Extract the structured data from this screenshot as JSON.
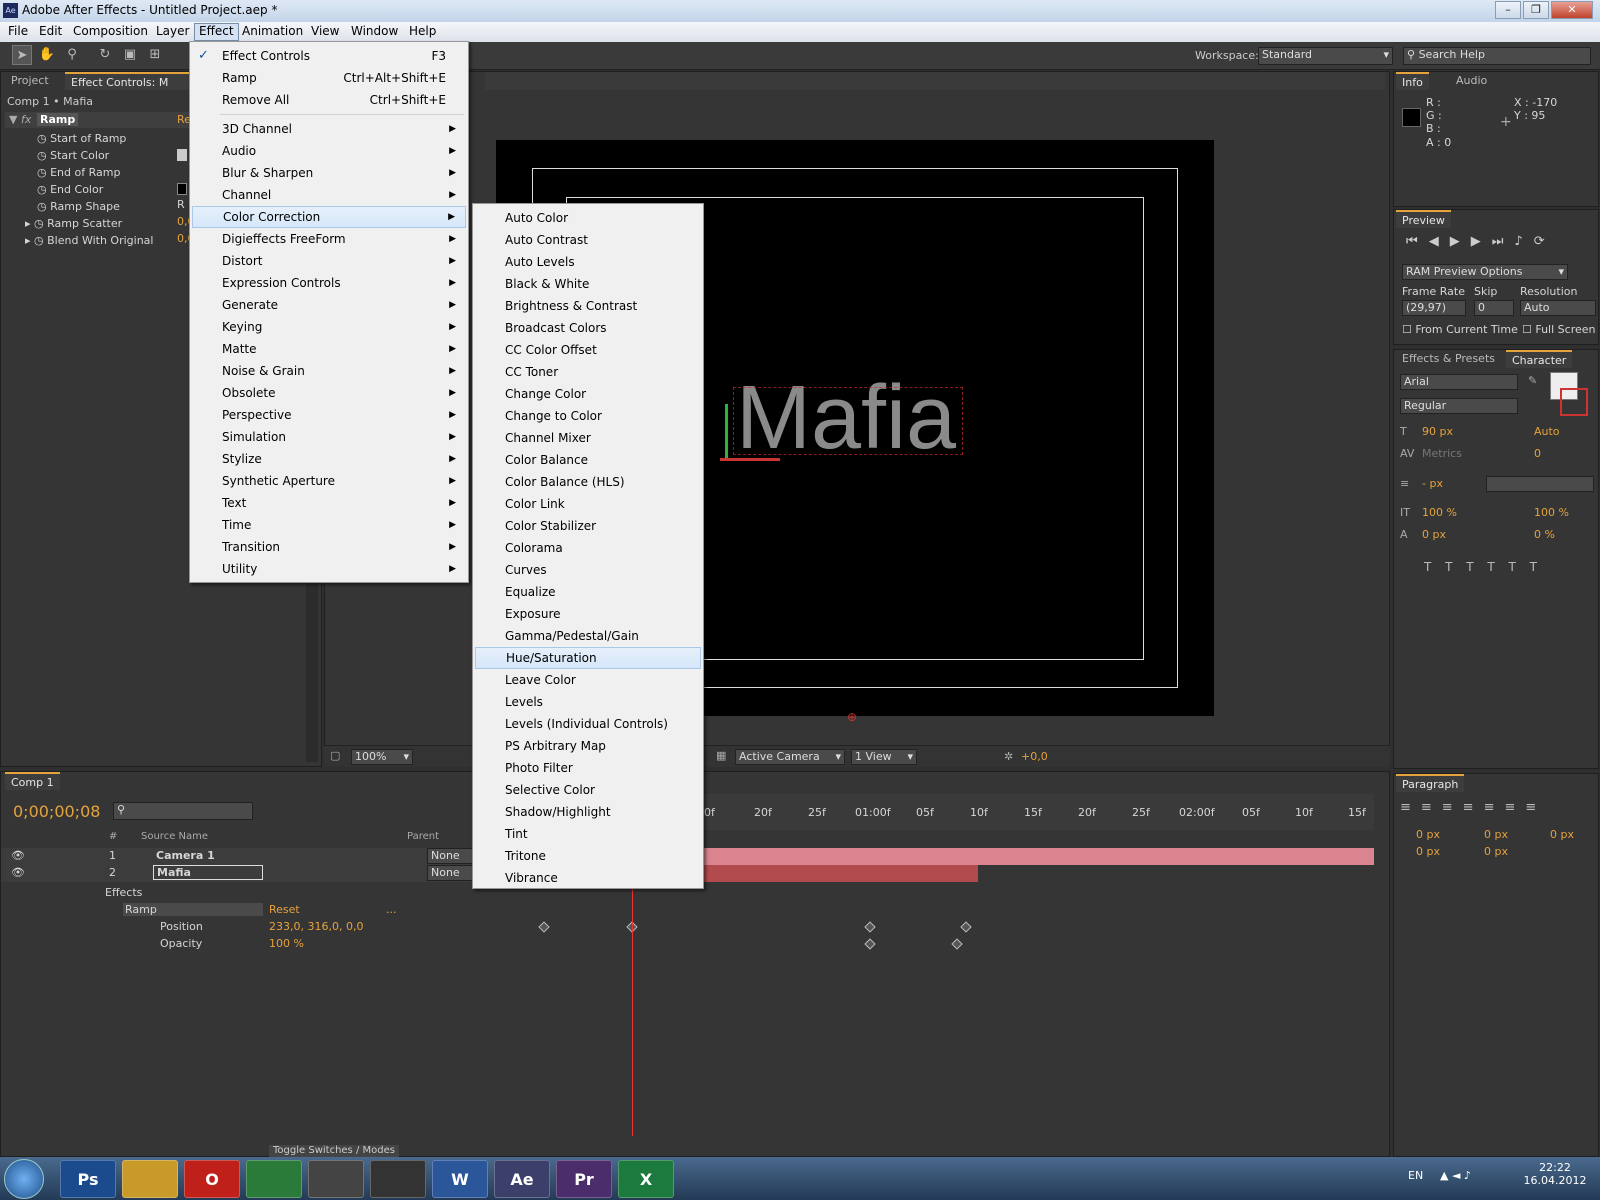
{
  "app": {
    "title": "Adobe After Effects - Untitled Project.aep *",
    "icon": "Ae"
  },
  "menubar": [
    "File",
    "Edit",
    "Composition",
    "Layer",
    "Effect",
    "Animation",
    "View",
    "Window",
    "Help"
  ],
  "toolbar": {
    "workspace_label": "Workspace:",
    "workspace_value": "Standard",
    "search_placeholder": "Search Help"
  },
  "effect_menu": {
    "top": [
      {
        "label": "Effect Controls",
        "shortcut": "F3",
        "checked": true
      },
      {
        "label": "Ramp",
        "shortcut": "Ctrl+Alt+Shift+E"
      },
      {
        "label": "Remove All",
        "shortcut": "Ctrl+Shift+E"
      }
    ],
    "categories": [
      "3D Channel",
      "Audio",
      "Blur & Sharpen",
      "Channel",
      "Color Correction",
      "Digieffects FreeForm",
      "Distort",
      "Expression Controls",
      "Generate",
      "Keying",
      "Matte",
      "Noise & Grain",
      "Obsolete",
      "Perspective",
      "Simulation",
      "Stylize",
      "Synthetic Aperture",
      "Text",
      "Time",
      "Transition",
      "Utility"
    ],
    "highlighted": "Color Correction"
  },
  "color_correction_menu": {
    "items": [
      "Auto Color",
      "Auto Contrast",
      "Auto Levels",
      "Black & White",
      "Brightness & Contrast",
      "Broadcast Colors",
      "CC Color Offset",
      "CC Toner",
      "Change Color",
      "Change to Color",
      "Channel Mixer",
      "Color Balance",
      "Color Balance (HLS)",
      "Color Link",
      "Color Stabilizer",
      "Colorama",
      "Curves",
      "Equalize",
      "Exposure",
      "Gamma/Pedestal/Gain",
      "Hue/Saturation",
      "Leave Color",
      "Levels",
      "Levels (Individual Controls)",
      "PS Arbitrary Map",
      "Photo Filter",
      "Selective Color",
      "Shadow/Highlight",
      "Tint",
      "Tritone",
      "Vibrance"
    ],
    "highlighted": "Hue/Saturation"
  },
  "effect_controls": {
    "tab_project": "Project",
    "tab_effect": "Effect Controls: M",
    "breadcrumb": "Comp 1 • Mafia",
    "effect_name": "Ramp",
    "reset": "Re",
    "props": [
      {
        "label": "Start of Ramp",
        "val": ""
      },
      {
        "label": "Start Color",
        "val": ""
      },
      {
        "label": "End of Ramp",
        "val": ""
      },
      {
        "label": "End Color",
        "val": ""
      },
      {
        "label": "Ramp Shape",
        "val": "R"
      },
      {
        "label": "Ramp Scatter",
        "val": "0,0"
      },
      {
        "label": "Blend With Original",
        "val": "0,0"
      }
    ]
  },
  "viewer": {
    "text": "Mafia",
    "zoom": "100%",
    "camera": "Active Camera",
    "views": "1 View",
    "exposure": "+0,0"
  },
  "info": {
    "tab_info": "Info",
    "tab_audio": "Audio",
    "r": "R :",
    "g": "G :",
    "b": "B :",
    "a": "A : 0",
    "x": "X : -170",
    "y": "Y : 95"
  },
  "preview": {
    "tab": "Preview",
    "ram_options": "RAM Preview Options",
    "frame_rate_label": "Frame Rate",
    "skip_label": "Skip",
    "resolution_label": "Resolution",
    "frame_rate": "(29,97)",
    "skip": "0",
    "resolution": "Auto",
    "from_current": "From Current Time",
    "full_screen": "Full Screen"
  },
  "character": {
    "tab_effects": "Effects & Presets",
    "tab_char": "Character",
    "font": "Arial",
    "style": "Regular",
    "size": "90 px",
    "leading": "Auto",
    "kerning": "Metrics",
    "tracking": "0",
    "stroke": "- px",
    "vscale": "100 %",
    "hscale": "100 %",
    "baseline": "0 px",
    "tsume": "0 %"
  },
  "paragraph": {
    "tab": "Paragraph",
    "v1": "0 px",
    "v2": "0 px",
    "v3": "0 px",
    "v4": "0 px",
    "v5": "0 px"
  },
  "timeline": {
    "tab": "Comp 1",
    "timecode": "0;00;00;08",
    "col_hash": "#",
    "col_source": "Source Name",
    "col_parent": "Parent",
    "ruler": [
      "0f",
      "20f",
      "25f",
      "01:00f",
      "05f",
      "10f",
      "15f",
      "20f",
      "25f",
      "02:00f",
      "05f",
      "10f",
      "15f"
    ],
    "layers": [
      {
        "num": "1",
        "name": "Camera 1",
        "parent": "None"
      },
      {
        "num": "2",
        "name": "Mafia",
        "parent": "None"
      }
    ],
    "effects_label": "Effects",
    "ramp_label": "Ramp",
    "ramp_reset": "Reset",
    "ramp_dots": "...",
    "position_label": "Position",
    "position_val": "233,0, 316,0, 0,0",
    "opacity_label": "Opacity",
    "opacity_val": "100 %",
    "toggle": "Toggle Switches / Modes"
  },
  "taskbar": {
    "apps": [
      "Ps",
      "",
      "O",
      "",
      "",
      "",
      "W",
      "Ae",
      "Pr",
      "X"
    ],
    "lang": "EN",
    "time": "22:22",
    "date": "16.04.2012"
  }
}
